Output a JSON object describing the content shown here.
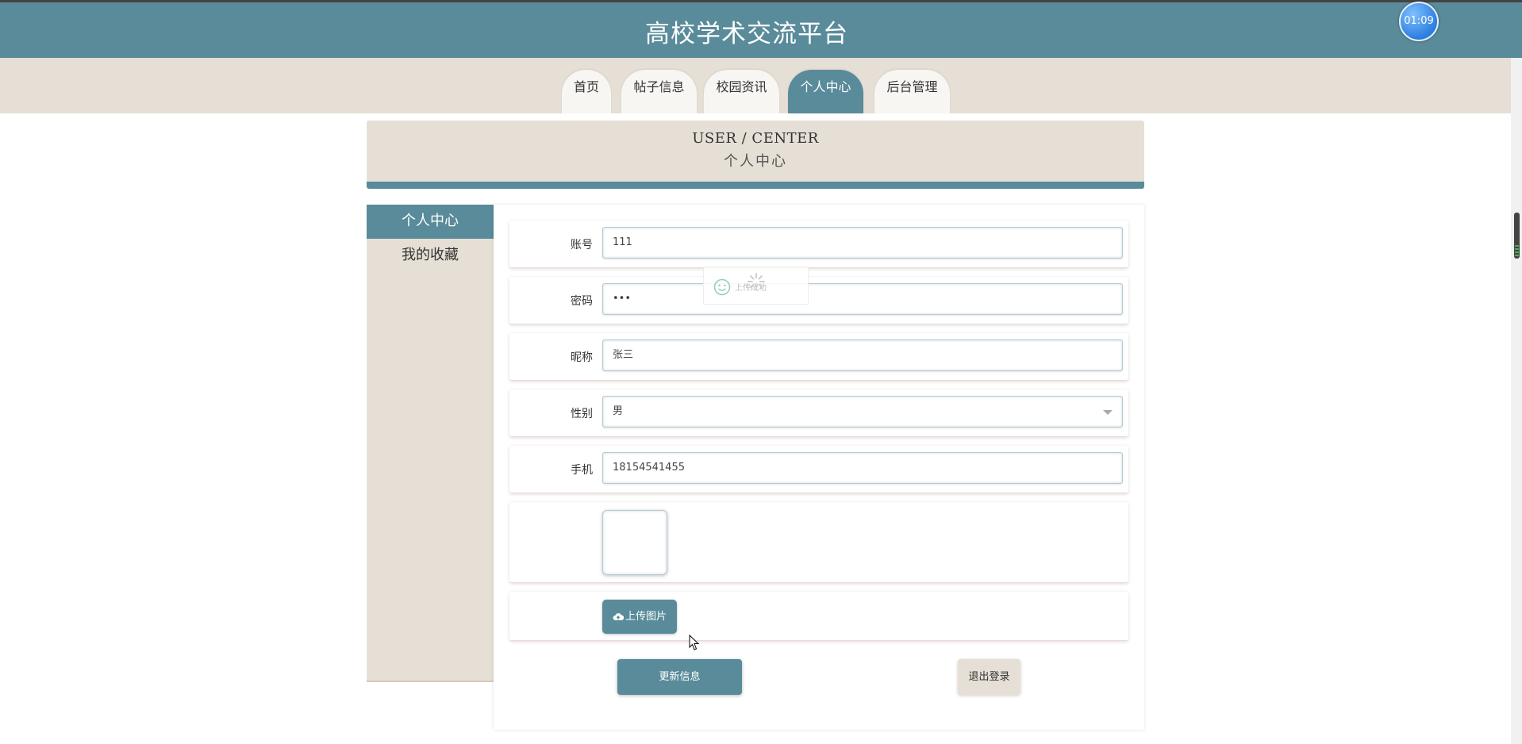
{
  "header": {
    "site_title": "高校学术交流平台",
    "timer": "01:09"
  },
  "nav": {
    "items": [
      {
        "label": "首页",
        "active": false
      },
      {
        "label": "帖子信息",
        "active": false
      },
      {
        "label": "校园资讯",
        "active": false
      },
      {
        "label": "个人中心",
        "active": true
      },
      {
        "label": "后台管理",
        "active": false
      }
    ]
  },
  "banner": {
    "title_en": "USER / CENTER",
    "title_cn": "个人中心"
  },
  "side_menu": {
    "items": [
      {
        "label": "个人中心",
        "active": true
      },
      {
        "label": "我的收藏",
        "active": false
      }
    ]
  },
  "form": {
    "account": {
      "label": "账号",
      "value": "111"
    },
    "password": {
      "label": "密码",
      "value": "•••"
    },
    "nickname": {
      "label": "昵称",
      "value": "张三"
    },
    "gender": {
      "label": "性别",
      "value": "男"
    },
    "phone": {
      "label": "手机",
      "value": "18154541455"
    },
    "upload_label": "上传图片",
    "update_label": "更新信息",
    "logout_label": "退出登录"
  },
  "toast": {
    "message": "上传成功"
  },
  "colors": {
    "primary": "#598b9a",
    "beige": "#e6dfd5"
  }
}
